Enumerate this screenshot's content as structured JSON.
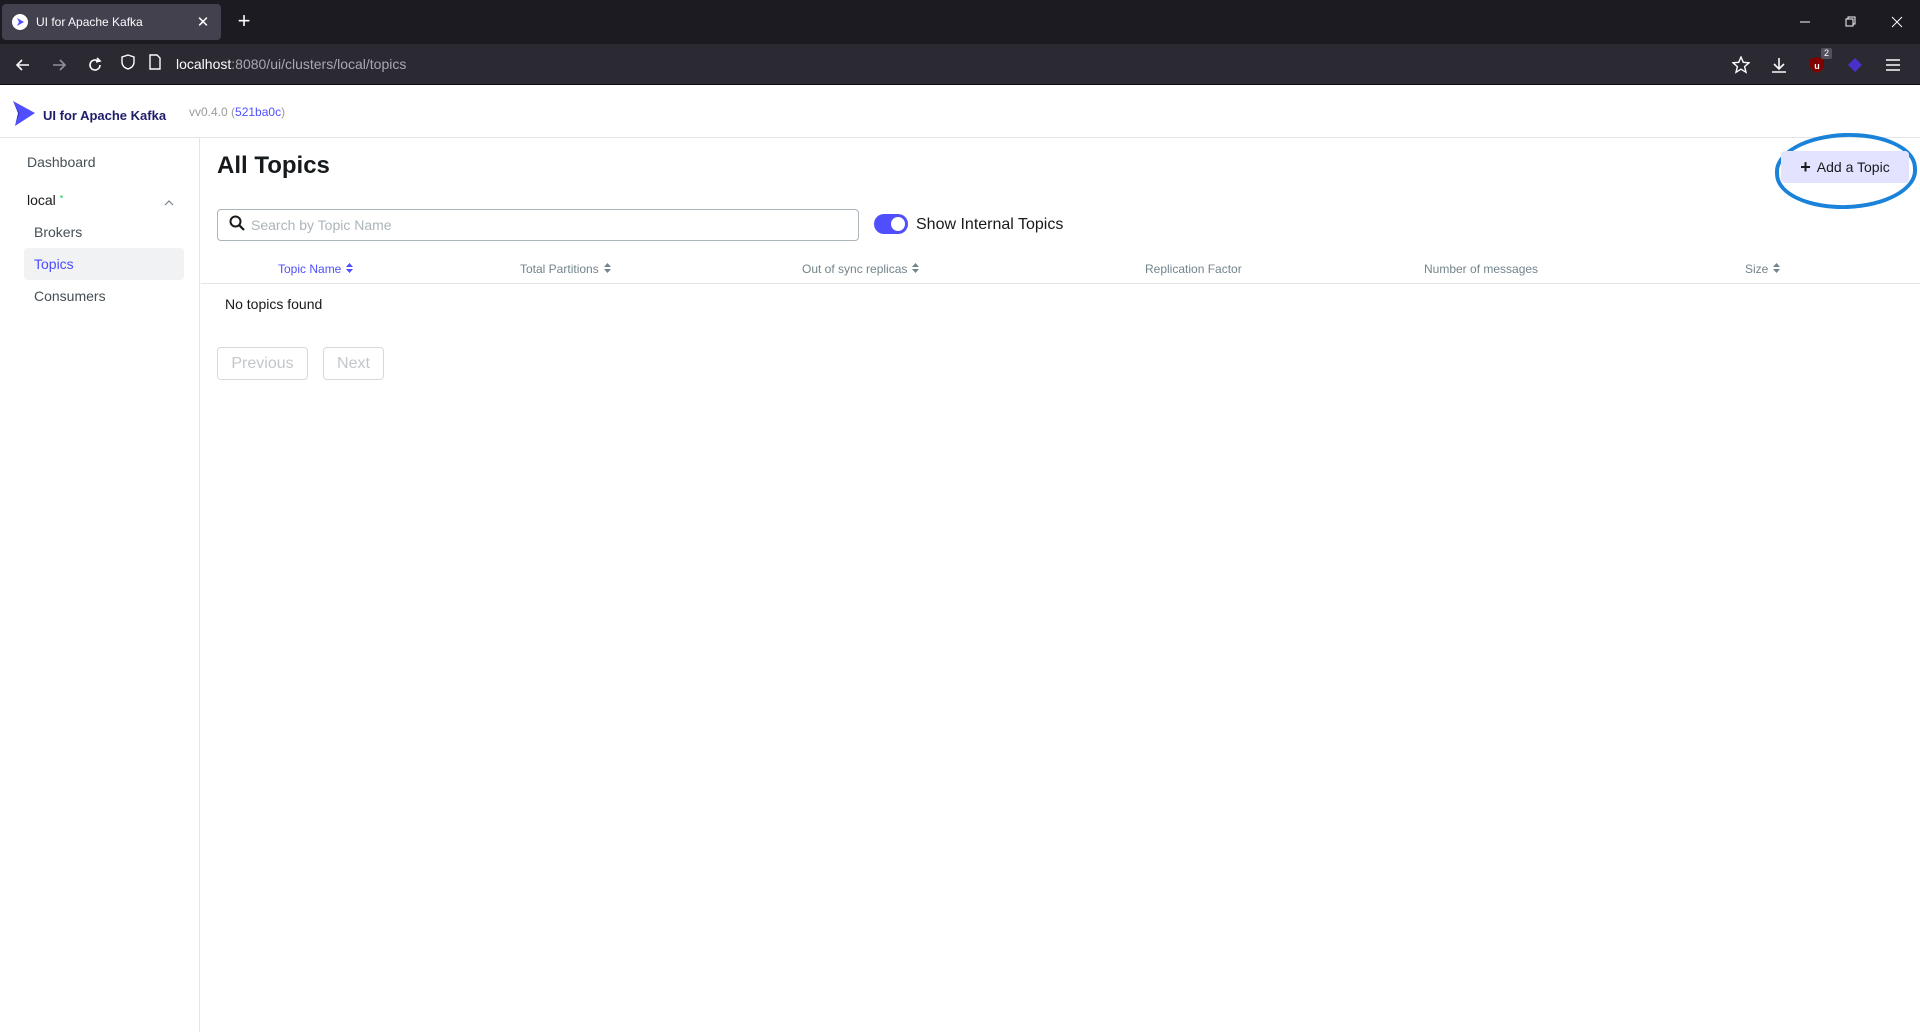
{
  "browser": {
    "tab_title": "UI for Apache Kafka",
    "url_host": "localhost",
    "url_path": ":8080/ui/clusters/local/topics",
    "extension_badge": "2"
  },
  "header": {
    "app_name": "UI for Apache Kafka",
    "version": "vv0.4.0 (",
    "commit": "521ba0c",
    "version_close": ")"
  },
  "sidebar": {
    "dashboard": "Dashboard",
    "cluster_name": "local",
    "items": [
      {
        "label": "Brokers"
      },
      {
        "label": "Topics"
      },
      {
        "label": "Consumers"
      }
    ]
  },
  "main": {
    "title": "All Topics",
    "add_button": "Add a Topic",
    "search_placeholder": "Search by Topic Name",
    "toggle_label": "Show Internal Topics",
    "columns": [
      "Topic Name",
      "Total Partitions",
      "Out of sync replicas",
      "Replication Factor",
      "Number of messages",
      "Size"
    ],
    "empty_message": "No topics found",
    "prev_button": "Previous",
    "next_button": "Next"
  },
  "colors": {
    "accent": "#4f4fff",
    "annotation": "#1a82d9",
    "status_online": "#5cd685"
  }
}
